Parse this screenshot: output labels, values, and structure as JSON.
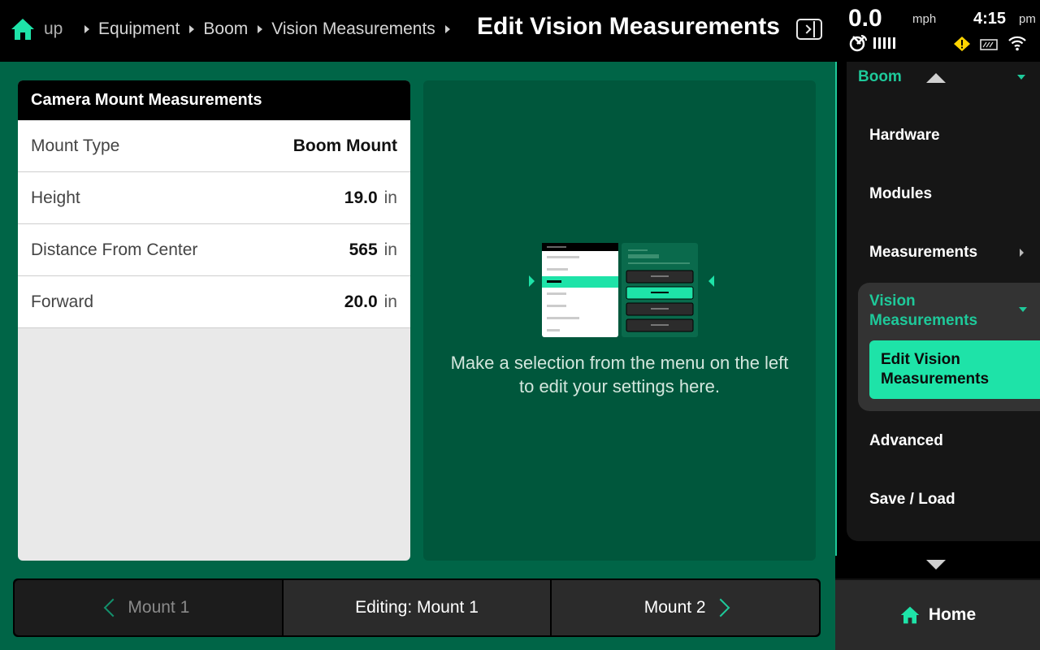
{
  "breadcrumb": {
    "items": [
      "Setup",
      "Equipment",
      "Boom",
      "Vision Measurements"
    ],
    "visible_truncated": "up"
  },
  "header": {
    "title": "Edit Vision Measurements"
  },
  "status": {
    "speed": "0.0",
    "speed_unit": "mph",
    "time": "4:15",
    "ampm": "pm",
    "icons": [
      "gps-icon",
      "signal-bars-icon",
      "warning-icon",
      "tank-icon",
      "wifi-icon"
    ],
    "warning_color": "#ffd400"
  },
  "card": {
    "title": "Camera Mount Measurements",
    "rows": [
      {
        "label": "Mount Type",
        "value": "Boom Mount",
        "unit": ""
      },
      {
        "label": "Height",
        "value": "19.0",
        "unit": "in"
      },
      {
        "label": "Distance From Center",
        "value": "565",
        "unit": "in"
      },
      {
        "label": "Forward",
        "value": "20.0",
        "unit": "in"
      }
    ]
  },
  "info": {
    "message": "Make a selection from the menu on the left to edit your settings here."
  },
  "bottom_nav": {
    "prev": "Mount 1",
    "current": "Editing: Mount 1",
    "next": "Mount 2"
  },
  "sidebar": {
    "header": "Boom",
    "items": [
      {
        "label": "Hardware"
      },
      {
        "label": "Modules"
      },
      {
        "label": "Measurements"
      },
      {
        "label": "Advanced"
      },
      {
        "label": "Save / Load"
      }
    ],
    "group": {
      "label": "Vision Measurements",
      "active_item": "Edit Vision Measurements"
    },
    "home_label": "Home"
  },
  "colors": {
    "accent": "#1ee3a8",
    "main_bg": "#006547",
    "info_bg": "#00573c"
  }
}
